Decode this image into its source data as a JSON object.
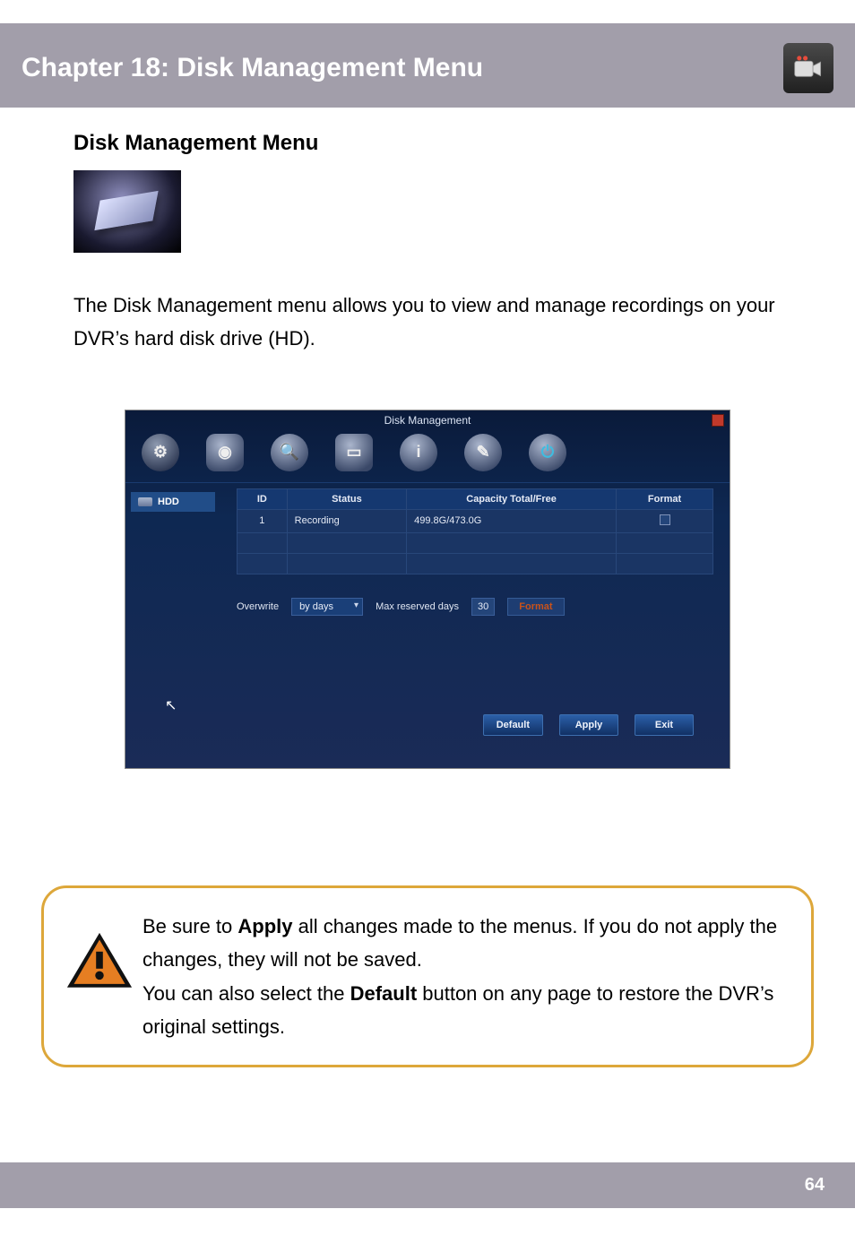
{
  "header": {
    "title": "Chapter 18: Disk Management Menu"
  },
  "section": {
    "heading": "Disk Management Menu",
    "intro": "The Disk Management menu allows you to view and manage recordings on your DVR’s hard disk drive (HD)."
  },
  "dvr": {
    "title": "Disk Management",
    "side_tab": "HDD",
    "table": {
      "headers": {
        "id": "ID",
        "status": "Status",
        "capacity": "Capacity Total/Free",
        "format": "Format"
      },
      "row": {
        "id": "1",
        "status": "Recording",
        "capacity": "499.8G/473.0G"
      }
    },
    "overwrite_label": "Overwrite",
    "overwrite_value": "by days",
    "max_reserved_label": "Max reserved days",
    "max_reserved_value": "30",
    "format_button": "Format",
    "buttons": {
      "default": "Default",
      "apply": "Apply",
      "exit": "Exit"
    }
  },
  "warning": {
    "line1a": "Be sure to ",
    "bold1": "Apply",
    "line1b": " all changes made to the menus. If you do not apply the changes, they will not be saved.",
    "line2a": "You can also select the ",
    "bold2": "Default",
    "line2b": " button on any page to restore the DVR’s original settings."
  },
  "page_number": "64"
}
